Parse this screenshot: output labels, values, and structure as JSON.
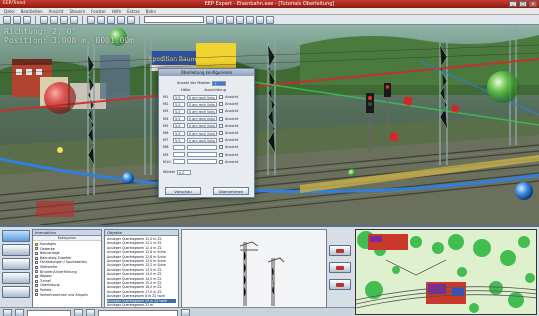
{
  "window": {
    "app_name": "EEP/Trend",
    "title": "EEP Expert - Eisenbahn.exe - [Tutorials Oberleitung]",
    "close_glyph": "✕",
    "maximize_glyph": "□",
    "minimize_glyph": "_"
  },
  "menu": [
    "Datei",
    "Bearbeiten",
    "Ansicht",
    "Steuern",
    "Fenster",
    "Hilfe",
    "Extras",
    "Bahn"
  ],
  "toolbar": {
    "combo_value": ""
  },
  "hud": {
    "line1": "Richtung: 2, 0°",
    "line2": "Position: 3.008 m, 0001.00m"
  },
  "scene": {
    "billboard_text": "Spedition Baum & Reich"
  },
  "dialog": {
    "title": "Oberleitung konfigurieren",
    "count_label": "Anzahl der Masten",
    "count_value": "7",
    "columns": {
      "height": "Höhe",
      "direction": "Ausrichtung"
    },
    "rows": [
      {
        "label": "M1",
        "height": "5.5",
        "direction": "0 am rech links",
        "check": "Ansicht"
      },
      {
        "label": "M2",
        "height": "5.5",
        "direction": "0 am rech links",
        "check": "Ansicht"
      },
      {
        "label": "M3",
        "height": "5.5",
        "direction": "0 am rech links",
        "check": "Ansicht"
      },
      {
        "label": "M4",
        "height": "5.5",
        "direction": "0 am rech links",
        "check": "Ansicht"
      },
      {
        "label": "M5",
        "height": "5.5",
        "direction": "0 am rech links",
        "check": "Ansicht"
      },
      {
        "label": "M6",
        "height": "5.5",
        "direction": "0 am rech links",
        "check": "Ansicht"
      },
      {
        "label": "M7",
        "height": "5.5",
        "direction": "0 am rech links",
        "check": "Ansicht"
      },
      {
        "label": "M8",
        "height": "",
        "direction": "",
        "check": "Ansicht"
      },
      {
        "label": "M9",
        "height": "",
        "direction": "",
        "check": "Ansicht"
      },
      {
        "label": "M10",
        "height": "",
        "direction": "",
        "check": "Ansicht"
      }
    ],
    "angle_label": "Winkel",
    "angle_value": "0.0",
    "preview_button": "Vorschau",
    "apply_button": "Übernehmen"
  },
  "bottom": {
    "category_header": "Immobilien",
    "category_subheader": "Kategorien",
    "categories": [
      {
        "label": "Sonstiges",
        "folder": true
      },
      {
        "label": "Gewerbe",
        "folder": false
      },
      {
        "label": "Bahnanlage",
        "folder": false
      },
      {
        "label": "Bahnsteig Zubehör",
        "folder": false
      },
      {
        "label": "Fahrleitungen / Spurtabellen",
        "folder": false
      },
      {
        "label": "Stellwerke",
        "folder": false
      },
      {
        "label": "Brücken/Unterführung",
        "folder": false
      },
      {
        "label": "Wasser",
        "folder": false
      },
      {
        "label": "Tunnel",
        "folder": false
      },
      {
        "label": "Oberleitung",
        "folder": false
      },
      {
        "label": "Portale",
        "folder": false
      },
      {
        "label": "Verkehrszeichen und Ampeln",
        "folder": false
      }
    ],
    "objects_header": "Objekte",
    "objects": [
      "Ausleger Quertragwerk 12,0 m Z2",
      "Ausleger Quertragwerk 12,2 m Z2",
      "Ausleger Quertragwerk 12,4 m Z2",
      "Ausleger Quertragwerk 12,6 m Schw",
      "Ausleger Quertragwerk 12,8 m Schw",
      "Ausleger Quertragwerk 13,0 m Schw",
      "Ausleger Quertragwerk 13,2 m Schw",
      "Ausleger Quertragwerk 13,5 m Z2",
      "Ausleger Quertragwerk 14,0 m Z2",
      "Ausleger Quertragwerk 14,5 m Z2",
      "Ausleger Quertragwerk 15,0 m Z2",
      "Ausleger Quertragwerk 16,0 m Z2",
      "Ausleger Quertragwerk 17,0 m Z2",
      "Ausleger Quertragwerk 8 m Z2 hoch",
      "Ausleger Quertragwerk 20 m Z2 hoch",
      "Ausleger Quertragwerk 22 m",
      "Ausleger Quertragwerk 24 m"
    ],
    "selected_object_index": 14,
    "status_field": ""
  },
  "colors": {
    "title_bar": "#c8382e",
    "selection": "#3a6ea8",
    "dialog_bg": "#e8ecf0"
  }
}
